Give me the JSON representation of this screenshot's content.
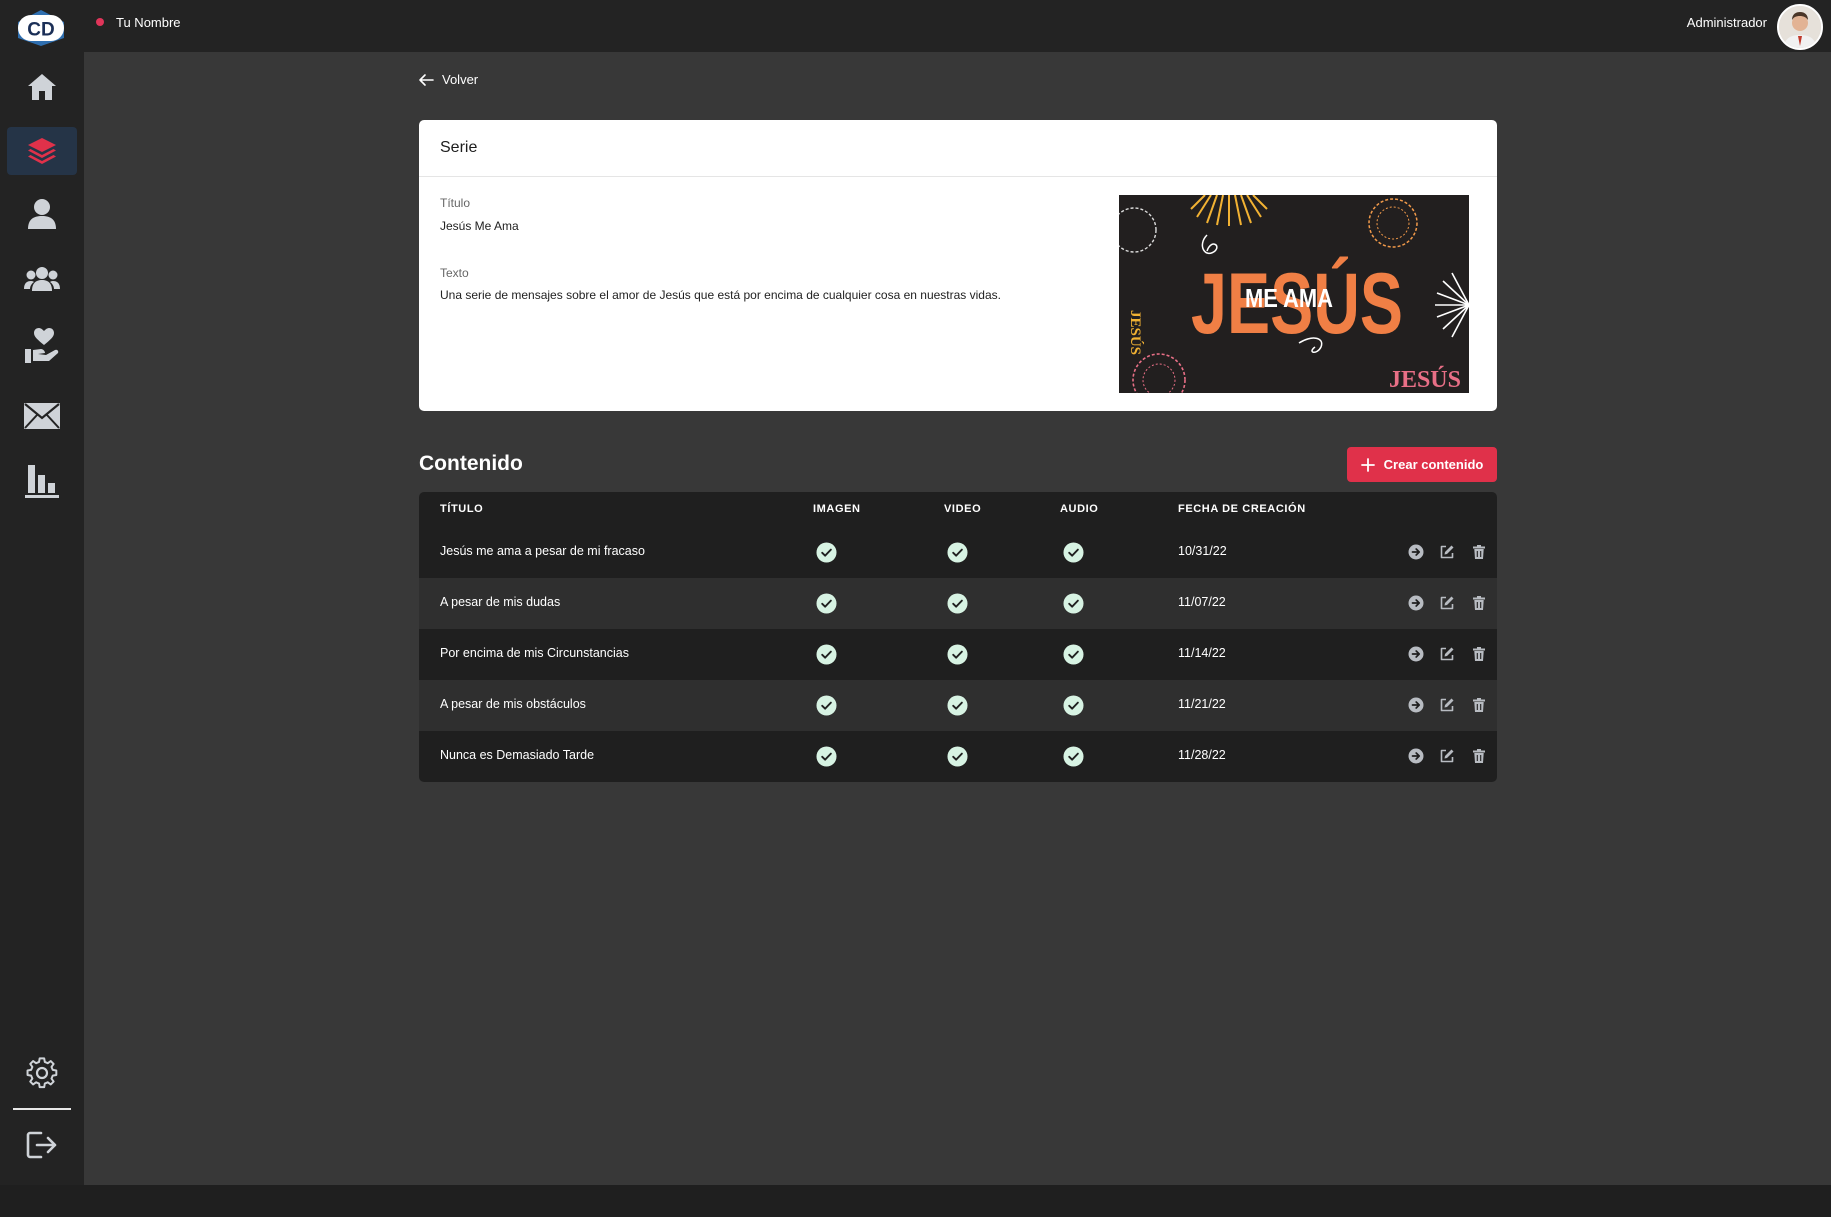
{
  "app": {
    "logo_text": "CD",
    "accent": "#e0314a"
  },
  "topbar": {
    "user_name": "Tu Nombre",
    "role": "Administrador"
  },
  "sidebar": {
    "items": [
      {
        "name": "home-icon"
      },
      {
        "name": "layers-icon",
        "active": true
      },
      {
        "name": "user-icon"
      },
      {
        "name": "users-icon"
      },
      {
        "name": "hand-heart-icon"
      },
      {
        "name": "mail-icon"
      },
      {
        "name": "bar-chart-icon"
      }
    ],
    "bottom": [
      {
        "name": "gear-icon"
      },
      {
        "name": "logout-icon"
      }
    ]
  },
  "back": {
    "label": "Volver"
  },
  "serie": {
    "header": "Serie",
    "title_label": "Título",
    "title_value": "Jesús Me Ama",
    "text_label": "Texto",
    "text_value": "Una serie de mensajes sobre el amor de Jesús que está por encima de cualquier cosa en nuestras vidas.",
    "cover": {
      "word_main": "JESÚS",
      "word_overlay": "ME AMA",
      "word_corner": "JESÚS"
    }
  },
  "contenido": {
    "title": "Contenido",
    "create_label": "Crear contenido",
    "columns": [
      "TÍTULO",
      "IMAGEN",
      "VIDEO",
      "AUDIO",
      "FECHA DE CREACIÓN"
    ],
    "rows": [
      {
        "title": "Jesús me ama a pesar de mi fracaso",
        "imagen": true,
        "video": true,
        "audio": true,
        "fecha": "10/31/22"
      },
      {
        "title": "A pesar de mis dudas",
        "imagen": true,
        "video": true,
        "audio": true,
        "fecha": "11/07/22"
      },
      {
        "title": "Por encima de mis Circunstancias",
        "imagen": true,
        "video": true,
        "audio": true,
        "fecha": "11/14/22"
      },
      {
        "title": "A pesar de mis obstáculos",
        "imagen": true,
        "video": true,
        "audio": true,
        "fecha": "11/21/22"
      },
      {
        "title": "Nunca es Demasiado Tarde",
        "imagen": true,
        "video": true,
        "audio": true,
        "fecha": "11/28/22"
      }
    ]
  }
}
